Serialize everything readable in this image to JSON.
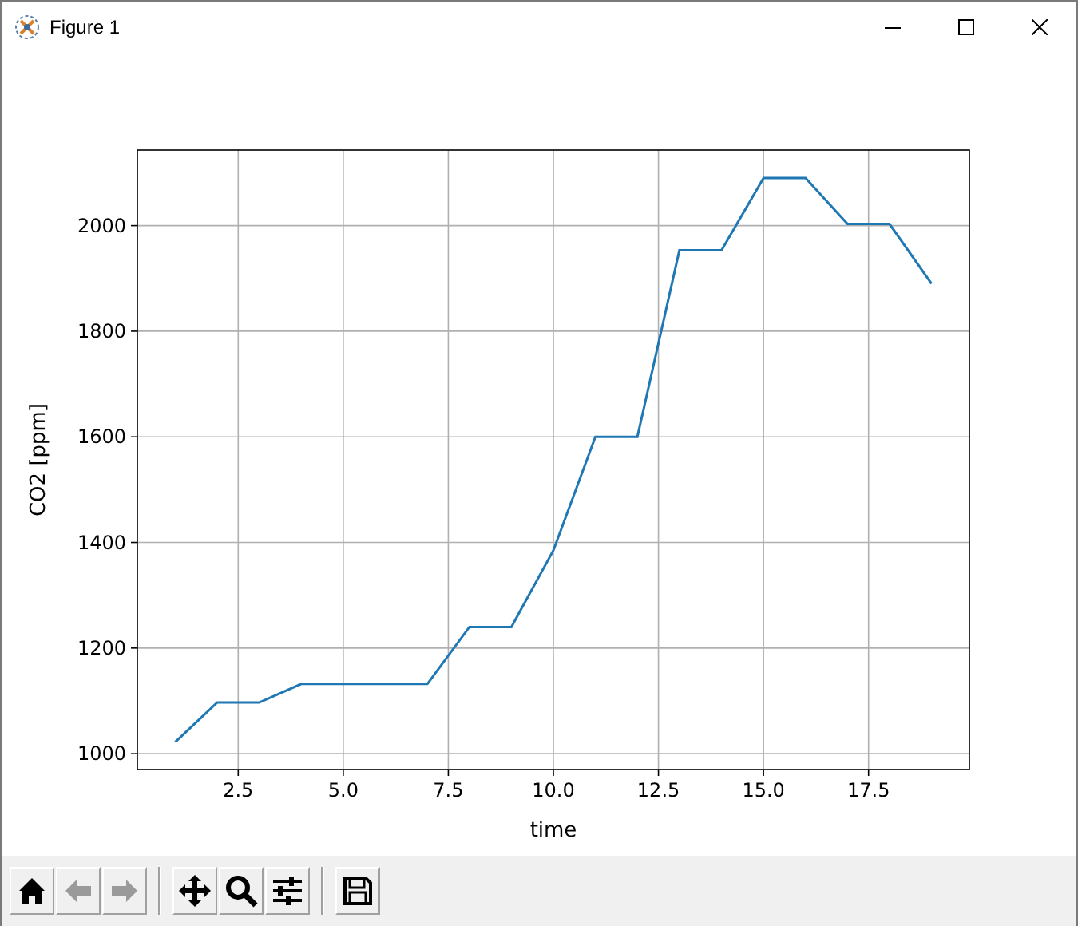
{
  "window": {
    "title": "Figure 1"
  },
  "chart": {
    "chart_data": {
      "type": "line",
      "grid": true,
      "xlabel": "time",
      "ylabel": "CO2 [ppm]",
      "xlim": [
        0.1,
        19.9
      ],
      "ylim": [
        970,
        2143
      ],
      "xticks": [
        {
          "value": 2.5,
          "label": "2.5"
        },
        {
          "value": 5,
          "label": "5.0"
        },
        {
          "value": 7.5,
          "label": "7.5"
        },
        {
          "value": 10,
          "label": "10.0"
        },
        {
          "value": 12.5,
          "label": "12.5"
        },
        {
          "value": 15,
          "label": "15.0"
        },
        {
          "value": 17.5,
          "label": "17.5"
        }
      ],
      "yticks": [
        1000,
        1200,
        1400,
        1600,
        1800,
        2000
      ],
      "x": [
        1,
        2,
        3,
        4,
        5,
        6,
        7,
        8,
        9,
        10,
        11,
        12,
        13,
        14,
        15,
        16,
        17,
        18,
        19
      ],
      "series": [
        {
          "color": "#1f77b4",
          "values": [
            1022,
            1097,
            1097,
            1132,
            1132,
            1132,
            1132,
            1240,
            1240,
            1385,
            1600,
            1600,
            1953,
            1953,
            2090,
            2090,
            2003,
            2003,
            1890
          ]
        }
      ]
    }
  },
  "toolbar": {
    "buttons": [
      {
        "kind": "home",
        "disabled": false
      },
      {
        "kind": "back",
        "disabled": true
      },
      {
        "kind": "forward",
        "disabled": true
      },
      {
        "kind": "separator"
      },
      {
        "kind": "pan",
        "disabled": false
      },
      {
        "kind": "zoom",
        "disabled": false
      },
      {
        "kind": "configure",
        "disabled": false
      },
      {
        "kind": "separator"
      },
      {
        "kind": "save",
        "disabled": false
      }
    ]
  }
}
